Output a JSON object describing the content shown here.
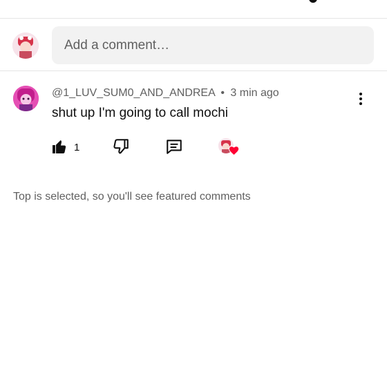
{
  "comment_input": {
    "placeholder": "Add a comment…"
  },
  "comment": {
    "author": "@1_LUV_SUM0_AND_ANDREA",
    "separator": "•",
    "time": "3 min ago",
    "text": "shut up I'm going to call mochi",
    "likes": "1",
    "creator_hearted": true
  },
  "sort_note": "Top is selected, so you'll see featured comments",
  "colors": {
    "heart": "#ff0033",
    "meta_text": "#606060",
    "input_bg": "#f2f2f2"
  },
  "icons": [
    "thumbs-up-icon",
    "thumbs-down-icon",
    "reply-icon",
    "more-vert-icon",
    "heart-icon"
  ]
}
